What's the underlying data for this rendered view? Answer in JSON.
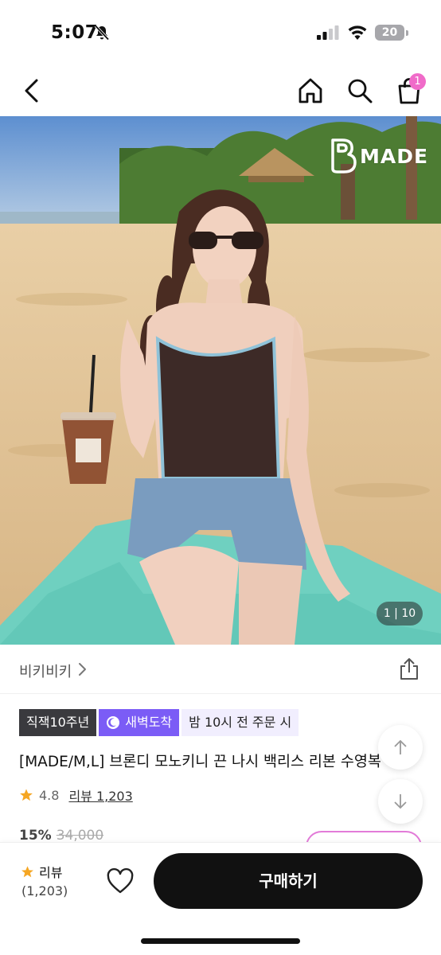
{
  "status_bar": {
    "time": "5:07",
    "battery": "20"
  },
  "nav": {
    "cart_count": "1"
  },
  "hero": {
    "brand_text": "MADE",
    "counter": "1 | 10"
  },
  "seller": {
    "name": "비키비키"
  },
  "tags": [
    {
      "label": "직잭10주년"
    },
    {
      "label": "새벽도착"
    },
    {
      "label": "밤 10시 전 주문 시"
    }
  ],
  "product": {
    "title": "[MADE/M,L] 브론디 모노키니 끈 나시 백리스 리본 수영복",
    "rating": "4.8",
    "reviews_link": "리뷰 1,203",
    "discount": "15%",
    "original_price": "34,000"
  },
  "bottom_bar": {
    "review_label": "리뷰",
    "review_count": "(1,203)",
    "buy_label": "구매하기"
  },
  "colors": {
    "accent_pink": "#f06bc9",
    "tag_purple": "#7b5cf6",
    "tag_dark": "#3a3a3e",
    "buy_button": "#111111",
    "star": "#f5a623"
  },
  "icons": [
    "back-icon",
    "home-icon",
    "search-icon",
    "cart-icon",
    "share-icon",
    "chevron-right-icon",
    "star-icon",
    "heart-icon",
    "arrow-up-icon",
    "arrow-down-icon",
    "moon-icon",
    "bell-slash-icon",
    "signal-icon",
    "wifi-icon"
  ]
}
